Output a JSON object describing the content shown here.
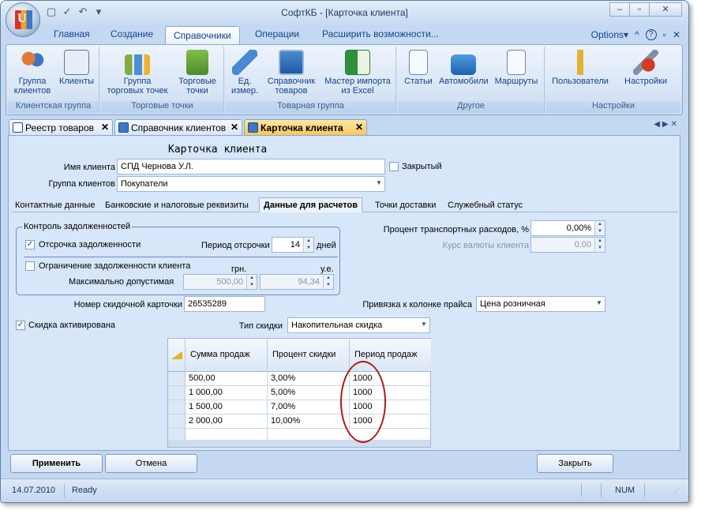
{
  "window": {
    "title": "СофтКБ - [Карточка клиента]"
  },
  "ribbon_tabs": [
    "Главная",
    "Создание",
    "Справочники",
    "Операции",
    "Расширить возможности..."
  ],
  "ribbon_right": {
    "options": "Options",
    "help": "?"
  },
  "ribbon_groups": [
    {
      "label": "Клиентская группа",
      "buttons": [
        "Группа клиентов",
        "Клиенты"
      ]
    },
    {
      "label": "Торговые точки",
      "buttons": [
        "Группа торговых точек",
        "Торговые точки"
      ]
    },
    {
      "label": "Товарная группа",
      "buttons": [
        "Ед. измер.",
        "Справочник товаров",
        "Мастер импорта из Excel"
      ]
    },
    {
      "label": "Другое",
      "buttons": [
        "Статьи",
        "Автомобили",
        "Маршруты"
      ]
    },
    {
      "label": "Настройки",
      "buttons": [
        "Пользователи",
        "Настройки"
      ]
    }
  ],
  "doc_tabs": [
    "Реестр товаров",
    "Справочник клиентов",
    "Карточка клиента"
  ],
  "form": {
    "heading": "Карточка клиента",
    "client_name_label": "Имя клиента",
    "client_name": "СПД Чернова У.Л.",
    "closed_label": "Закрытый",
    "client_group_label": "Группа клиентов",
    "client_group": "Покупатели",
    "tabs": [
      "Контактные данные",
      "Банковские и налоговые реквизиты",
      "Данные для расчетов",
      "Точки доставки",
      "Служебный статус"
    ],
    "debt_control_legend": "Контроль задолженностей",
    "deferral_label": "Отсрочка задолженности",
    "deferral_period_label": "Период отсрочки",
    "deferral_period": "14",
    "days_label": "дней",
    "debt_limit_label": "Ограничение задолженности клиента",
    "uah_label": "грн.",
    "ue_label": "у.е.",
    "max_allowed_label": "Максимально допустимая",
    "max_uah": "500,00",
    "max_ue": "94,34",
    "transport_label": "Процент транспортных расходов, %",
    "transport_value": "0,00%",
    "currency_rate_label": "Курс валюты клиента",
    "currency_rate_value": "0,00",
    "discount_card_label": "Номер скидочной карточки",
    "discount_card": "26535289",
    "price_column_label": "Привязка к колонке прайса",
    "price_column": "Цена розничная",
    "discount_active_label": "Скидка активирована",
    "discount_type_label": "Тип скидки",
    "discount_type": "Накопительная скидка"
  },
  "grid": {
    "columns": [
      "Сумма продаж",
      "Процент скидки",
      "Период продаж"
    ],
    "rows": [
      [
        "500,00",
        "3,00%",
        "1000"
      ],
      [
        "1 000,00",
        "5,00%",
        "1000"
      ],
      [
        "1 500,00",
        "7,00%",
        "1000"
      ],
      [
        "2 000,00",
        "10,00%",
        "1000"
      ]
    ]
  },
  "buttons": {
    "apply": "Применить",
    "cancel": "Отмена",
    "close": "Закрыть"
  },
  "status": {
    "date": "14.07.2010",
    "state": "Ready",
    "num": "NUM"
  }
}
